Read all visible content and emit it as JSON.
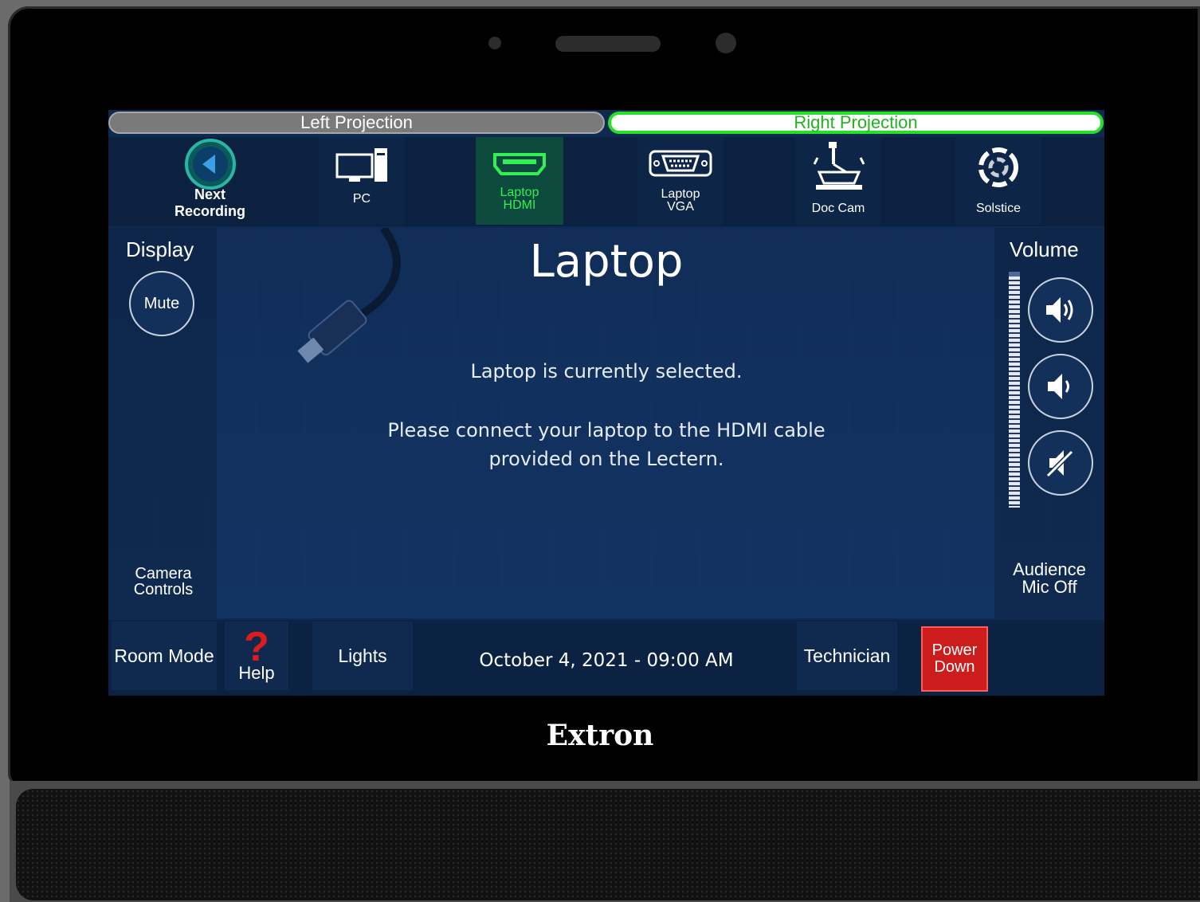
{
  "projection": {
    "left": "Left Projection",
    "right": "Right Projection"
  },
  "sources": [
    {
      "label_1": "Next",
      "label_2": "Recording",
      "icon": "back-arrow-circle-icon"
    },
    {
      "label_1": "PC",
      "icon": "desktop-pc-icon"
    },
    {
      "label_1": "Laptop",
      "label_2": "HDMI",
      "icon": "hdmi-port-icon",
      "active": true
    },
    {
      "label_1": "Laptop",
      "label_2": "VGA",
      "icon": "vga-port-icon"
    },
    {
      "label_1": "Doc Cam",
      "icon": "document-camera-icon"
    },
    {
      "label_1": "Solstice",
      "icon": "solstice-swirl-icon"
    }
  ],
  "display": {
    "title": "Display",
    "mute": "Mute"
  },
  "main": {
    "title": "Laptop",
    "status": "Laptop is currently selected.",
    "instruction_1": "Please connect your laptop to the HDMI cable",
    "instruction_2": "provided on the Lectern."
  },
  "volume": {
    "title": "Volume",
    "up_icon": "volume-up-icon",
    "down_icon": "volume-down-icon",
    "mute_icon": "volume-mute-icon"
  },
  "camera": {
    "line_1": "Camera",
    "line_2": "Controls"
  },
  "audience": {
    "line_1": "Audience",
    "line_2": "Mic Off"
  },
  "bottom": {
    "room_mode": "Room Mode",
    "help": "Help",
    "help_icon": "?",
    "lights": "Lights",
    "datetime": "October 4, 2021  -  09:00 AM",
    "technician": "Technician",
    "power_1": "Power",
    "power_2": "Down"
  },
  "brand": "Extron",
  "colors": {
    "active_green": "#33ee55",
    "power_red": "#cc1c1c",
    "screen_blue": "#0f2a50"
  }
}
